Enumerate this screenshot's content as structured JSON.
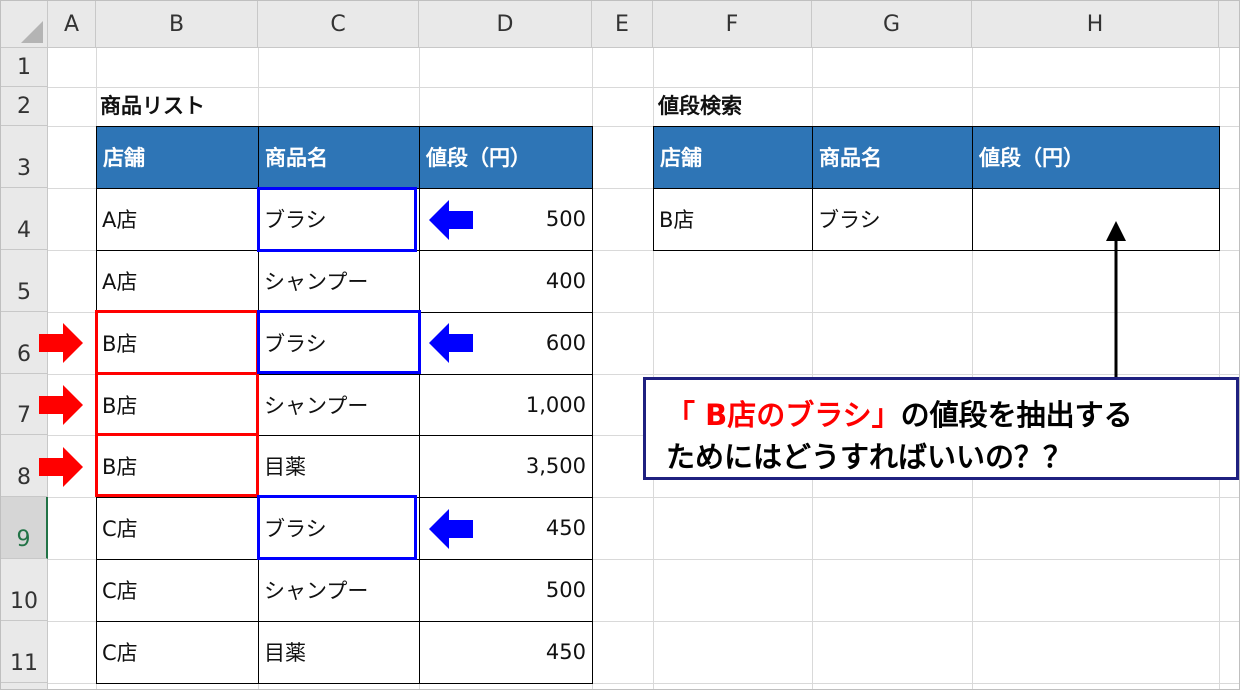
{
  "columns": [
    "A",
    "B",
    "C",
    "D",
    "E",
    "F",
    "G",
    "H"
  ],
  "rows": [
    "1",
    "2",
    "3",
    "4",
    "5",
    "6",
    "7",
    "8",
    "9",
    "10",
    "11"
  ],
  "selected_row": "9",
  "product_list": {
    "title": "商品リスト",
    "headers": [
      "店舗",
      "商品名",
      "値段（円）"
    ],
    "rows": [
      {
        "store": "A店",
        "item": "ブラシ",
        "price": "500"
      },
      {
        "store": "A店",
        "item": "シャンプー",
        "price": "400"
      },
      {
        "store": "B店",
        "item": "ブラシ",
        "price": "600"
      },
      {
        "store": "B店",
        "item": "シャンプー",
        "price": "1,000"
      },
      {
        "store": "B店",
        "item": "目薬",
        "price": "3,500"
      },
      {
        "store": "C店",
        "item": "ブラシ",
        "price": "450"
      },
      {
        "store": "C店",
        "item": "シャンプー",
        "price": "500"
      },
      {
        "store": "C店",
        "item": "目薬",
        "price": "450"
      }
    ]
  },
  "price_search": {
    "title": "値段検索",
    "headers": [
      "店舗",
      "商品名",
      "値段（円）"
    ],
    "row": {
      "store": "B店",
      "item": "ブラシ",
      "price": ""
    }
  },
  "callout": {
    "open": "「 ",
    "highlight": "B店のブラシ",
    "close": "」",
    "line1_rest": "の値段を抽出する",
    "line2": "ためにはどうすればいいの？？"
  },
  "colors": {
    "header_fill": "#2e75b6",
    "highlight_red": "#ff0000",
    "highlight_blue": "#0000ff",
    "callout_border": "#1f2080",
    "selected_row_text": "#217346"
  },
  "icons": {
    "red_arrow": "arrow-right-icon",
    "blue_arrow": "arrow-left-icon",
    "up_arrow": "arrow-up-icon"
  }
}
